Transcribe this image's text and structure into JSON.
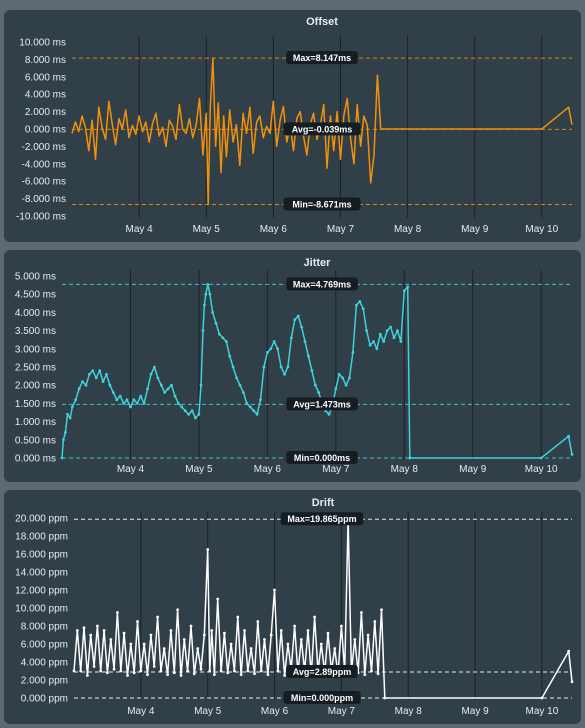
{
  "colors": {
    "background": "#5d6a72",
    "panel": "#303f48",
    "offset": "#f0910c",
    "jitter": "#3fd2db",
    "drift": "#ffffff",
    "label_bg": "#151d22"
  },
  "chart_data": [
    {
      "type": "line",
      "title": "Offset",
      "x_ticks": [
        "May 4",
        "May 5",
        "May 6",
        "May 7",
        "May 8",
        "May 9",
        "May 10"
      ],
      "y_ticks": [
        "10.000 ms",
        "8.000 ms",
        "6.000 ms",
        "4.000 ms",
        "2.000 ms",
        "0.000 ms",
        "-2.000 ms",
        "-4.000 ms",
        "-6.000 ms",
        "-8.000 ms",
        "-10.000 ms"
      ],
      "ylim": [
        -10,
        10
      ],
      "unit": "ms",
      "series_color": "#f0910c",
      "markers": false,
      "reference_lines": [
        {
          "label": "Max=8.147ms",
          "value": 8.147
        },
        {
          "label": "Avg=-0.039ms",
          "value": -0.039
        },
        {
          "label": "Min=-8.671ms",
          "value": -8.671
        }
      ],
      "series_x_days": [
        3.0,
        7.6,
        10.0,
        10.4
      ],
      "series_points": [
        [
          3.0,
          -0.5
        ],
        [
          3.05,
          0.8
        ],
        [
          3.1,
          -0.3
        ],
        [
          3.15,
          1.5
        ],
        [
          3.2,
          0.2
        ],
        [
          3.25,
          -2.5
        ],
        [
          3.3,
          1.0
        ],
        [
          3.35,
          -3.5
        ],
        [
          3.4,
          2.5
        ],
        [
          3.45,
          0.1
        ],
        [
          3.5,
          -1.2
        ],
        [
          3.55,
          3.2
        ],
        [
          3.6,
          0.5
        ],
        [
          3.65,
          -1.8
        ],
        [
          3.7,
          1.2
        ],
        [
          3.75,
          0.0
        ],
        [
          3.8,
          2.2
        ],
        [
          3.85,
          -1.0
        ],
        [
          3.9,
          0.4
        ],
        [
          3.95,
          -0.6
        ],
        [
          4.0,
          1.5
        ],
        [
          4.05,
          -0.3
        ],
        [
          4.1,
          0.8
        ],
        [
          4.15,
          -1.5
        ],
        [
          4.2,
          0.6
        ],
        [
          4.25,
          1.8
        ],
        [
          4.3,
          -0.8
        ],
        [
          4.35,
          0.2
        ],
        [
          4.4,
          -2.0
        ],
        [
          4.45,
          1.0
        ],
        [
          4.5,
          0.3
        ],
        [
          4.55,
          -1.2
        ],
        [
          4.6,
          2.8
        ],
        [
          4.65,
          0.0
        ],
        [
          4.7,
          -0.5
        ],
        [
          4.75,
          1.2
        ],
        [
          4.8,
          -1.0
        ],
        [
          4.85,
          0.5
        ],
        [
          4.9,
          3.5
        ],
        [
          4.95,
          -3.0
        ],
        [
          5.0,
          1.8
        ],
        [
          5.03,
          -8.671
        ],
        [
          5.06,
          2.5
        ],
        [
          5.1,
          8.147
        ],
        [
          5.14,
          -2.0
        ],
        [
          5.18,
          3.0
        ],
        [
          5.22,
          -5.0
        ],
        [
          5.26,
          1.5
        ],
        [
          5.3,
          -3.2
        ],
        [
          5.35,
          2.2
        ],
        [
          5.4,
          -1.5
        ],
        [
          5.45,
          0.5
        ],
        [
          5.5,
          -4.2
        ],
        [
          5.55,
          1.8
        ],
        [
          5.6,
          -0.5
        ],
        [
          5.65,
          2.5
        ],
        [
          5.7,
          -2.8
        ],
        [
          5.75,
          0.8
        ],
        [
          5.8,
          1.5
        ],
        [
          5.85,
          -1.0
        ],
        [
          5.9,
          0.3
        ],
        [
          5.95,
          -0.5
        ],
        [
          6.0,
          3.2
        ],
        [
          6.05,
          -2.0
        ],
        [
          6.1,
          1.0
        ],
        [
          6.15,
          2.6
        ],
        [
          6.2,
          -1.5
        ],
        [
          6.25,
          0.5
        ],
        [
          6.3,
          -2.5
        ],
        [
          6.35,
          1.2
        ],
        [
          6.4,
          2.0
        ],
        [
          6.45,
          -0.8
        ],
        [
          6.5,
          -3.0
        ],
        [
          6.55,
          0.6
        ],
        [
          6.6,
          1.8
        ],
        [
          6.65,
          -1.2
        ],
        [
          6.7,
          0.4
        ],
        [
          6.75,
          2.8
        ],
        [
          6.8,
          -4.5
        ],
        [
          6.85,
          1.5
        ],
        [
          6.9,
          -2.5
        ],
        [
          6.95,
          2.0
        ],
        [
          7.0,
          -3.5
        ],
        [
          7.05,
          1.5
        ],
        [
          7.1,
          3.5
        ],
        [
          7.15,
          -1.0
        ],
        [
          7.2,
          -4.0
        ],
        [
          7.25,
          2.8
        ],
        [
          7.3,
          -2.0
        ],
        [
          7.35,
          1.5
        ],
        [
          7.4,
          0.4
        ],
        [
          7.45,
          -6.2
        ],
        [
          7.5,
          -3.0
        ],
        [
          7.55,
          6.2
        ],
        [
          7.6,
          0.0
        ],
        [
          10.0,
          0.0
        ],
        [
          10.4,
          2.5
        ],
        [
          10.45,
          0.5
        ]
      ]
    },
    {
      "type": "line",
      "title": "Jitter",
      "x_ticks": [
        "May 4",
        "May 5",
        "May 6",
        "May 7",
        "May 8",
        "May 9",
        "May 10"
      ],
      "y_ticks": [
        "5.000 ms",
        "4.500 ms",
        "4.000 ms",
        "3.500 ms",
        "3.000 ms",
        "2.500 ms",
        "2.000 ms",
        "1.500 ms",
        "1.000 ms",
        "0.500 ms",
        "0.000 ms"
      ],
      "ylim": [
        0,
        5
      ],
      "unit": "ms",
      "series_color": "#3fd2db",
      "markers": true,
      "reference_lines": [
        {
          "label": "Max=4.769ms",
          "value": 4.769
        },
        {
          "label": "Avg=1.473ms",
          "value": 1.473
        },
        {
          "label": "Min=0.000ms",
          "value": 0.0
        }
      ],
      "series_points": [
        [
          3.0,
          0.0
        ],
        [
          3.02,
          0.5
        ],
        [
          3.05,
          0.7
        ],
        [
          3.08,
          1.2
        ],
        [
          3.12,
          1.1
        ],
        [
          3.15,
          1.4
        ],
        [
          3.2,
          1.6
        ],
        [
          3.25,
          1.9
        ],
        [
          3.3,
          2.1
        ],
        [
          3.35,
          2.0
        ],
        [
          3.4,
          2.3
        ],
        [
          3.45,
          2.4
        ],
        [
          3.5,
          2.2
        ],
        [
          3.55,
          2.4
        ],
        [
          3.6,
          2.1
        ],
        [
          3.65,
          2.3
        ],
        [
          3.7,
          2.0
        ],
        [
          3.75,
          1.8
        ],
        [
          3.8,
          1.6
        ],
        [
          3.85,
          1.7
        ],
        [
          3.9,
          1.5
        ],
        [
          3.95,
          1.6
        ],
        [
          4.0,
          1.4
        ],
        [
          4.05,
          1.6
        ],
        [
          4.1,
          1.5
        ],
        [
          4.15,
          1.7
        ],
        [
          4.2,
          1.5
        ],
        [
          4.25,
          1.9
        ],
        [
          4.3,
          2.3
        ],
        [
          4.35,
          2.5
        ],
        [
          4.4,
          2.2
        ],
        [
          4.45,
          2.0
        ],
        [
          4.5,
          1.8
        ],
        [
          4.55,
          1.9
        ],
        [
          4.6,
          2.0
        ],
        [
          4.65,
          1.7
        ],
        [
          4.7,
          1.5
        ],
        [
          4.75,
          1.4
        ],
        [
          4.8,
          1.3
        ],
        [
          4.85,
          1.2
        ],
        [
          4.9,
          1.3
        ],
        [
          4.95,
          1.1
        ],
        [
          5.0,
          1.2
        ],
        [
          5.03,
          2.0
        ],
        [
          5.06,
          3.5
        ],
        [
          5.08,
          4.2
        ],
        [
          5.1,
          4.5
        ],
        [
          5.13,
          4.769
        ],
        [
          5.16,
          4.5
        ],
        [
          5.2,
          4.0
        ],
        [
          5.25,
          3.7
        ],
        [
          5.3,
          3.4
        ],
        [
          5.35,
          3.3
        ],
        [
          5.4,
          3.2
        ],
        [
          5.45,
          2.8
        ],
        [
          5.5,
          2.5
        ],
        [
          5.55,
          2.2
        ],
        [
          5.6,
          2.0
        ],
        [
          5.65,
          1.8
        ],
        [
          5.7,
          1.5
        ],
        [
          5.75,
          1.4
        ],
        [
          5.8,
          1.3
        ],
        [
          5.85,
          1.2
        ],
        [
          5.9,
          1.6
        ],
        [
          5.95,
          2.5
        ],
        [
          6.0,
          2.9
        ],
        [
          6.05,
          3.0
        ],
        [
          6.1,
          3.2
        ],
        [
          6.15,
          3.0
        ],
        [
          6.2,
          2.5
        ],
        [
          6.25,
          2.3
        ],
        [
          6.3,
          2.5
        ],
        [
          6.35,
          3.3
        ],
        [
          6.4,
          3.8
        ],
        [
          6.45,
          3.9
        ],
        [
          6.5,
          3.6
        ],
        [
          6.55,
          3.2
        ],
        [
          6.6,
          2.8
        ],
        [
          6.65,
          2.4
        ],
        [
          6.7,
          2.0
        ],
        [
          6.75,
          1.8
        ],
        [
          6.8,
          1.5
        ],
        [
          6.85,
          1.3
        ],
        [
          6.9,
          1.2
        ],
        [
          6.95,
          1.4
        ],
        [
          7.0,
          1.9
        ],
        [
          7.05,
          2.3
        ],
        [
          7.1,
          2.2
        ],
        [
          7.15,
          2.0
        ],
        [
          7.2,
          2.2
        ],
        [
          7.25,
          2.9
        ],
        [
          7.3,
          4.2
        ],
        [
          7.35,
          4.3
        ],
        [
          7.4,
          4.1
        ],
        [
          7.45,
          3.5
        ],
        [
          7.5,
          3.1
        ],
        [
          7.55,
          3.2
        ],
        [
          7.6,
          3.0
        ],
        [
          7.65,
          3.4
        ],
        [
          7.7,
          3.2
        ],
        [
          7.75,
          3.5
        ],
        [
          7.8,
          3.6
        ],
        [
          7.85,
          3.3
        ],
        [
          7.9,
          3.5
        ],
        [
          7.95,
          3.2
        ],
        [
          8.0,
          4.6
        ],
        [
          8.05,
          4.7
        ],
        [
          8.08,
          0.0
        ],
        [
          10.0,
          0.0
        ],
        [
          10.4,
          0.6
        ],
        [
          10.45,
          0.1
        ]
      ]
    },
    {
      "type": "line",
      "title": "Drift",
      "x_ticks": [
        "May 4",
        "May 5",
        "May 6",
        "May 7",
        "May 8",
        "May 9",
        "May 10"
      ],
      "y_ticks": [
        "20.000 ppm",
        "18.000 ppm",
        "16.000 ppm",
        "14.000 ppm",
        "12.000 ppm",
        "10.000 ppm",
        "8.000 ppm",
        "6.000 ppm",
        "4.000 ppm",
        "2.000 ppm",
        "0.000 ppm"
      ],
      "ylim": [
        0,
        20
      ],
      "unit": "ppm",
      "series_color": "#ffffff",
      "markers": true,
      "reference_lines": [
        {
          "label": "Max=19.865ppm",
          "value": 19.865
        },
        {
          "label": "Avg=2.89ppm",
          "value": 2.89
        },
        {
          "label": "Min=0.000ppm",
          "value": 0.0
        }
      ],
      "series_points": [
        [
          3.0,
          3.0
        ],
        [
          3.05,
          7.5
        ],
        [
          3.1,
          3.0
        ],
        [
          3.15,
          7.8
        ],
        [
          3.2,
          2.5
        ],
        [
          3.25,
          7.0
        ],
        [
          3.3,
          3.5
        ],
        [
          3.35,
          8.0
        ],
        [
          3.4,
          3.0
        ],
        [
          3.45,
          7.5
        ],
        [
          3.5,
          2.8
        ],
        [
          3.55,
          6.5
        ],
        [
          3.6,
          3.2
        ],
        [
          3.65,
          9.5
        ],
        [
          3.7,
          3.0
        ],
        [
          3.75,
          7.2
        ],
        [
          3.8,
          2.5
        ],
        [
          3.85,
          6.0
        ],
        [
          3.9,
          2.8
        ],
        [
          3.95,
          8.5
        ],
        [
          4.0,
          3.0
        ],
        [
          4.05,
          6.0
        ],
        [
          4.1,
          2.6
        ],
        [
          4.15,
          7.0
        ],
        [
          4.2,
          3.5
        ],
        [
          4.25,
          9.0
        ],
        [
          4.3,
          3.0
        ],
        [
          4.35,
          5.5
        ],
        [
          4.4,
          2.6
        ],
        [
          4.45,
          7.5
        ],
        [
          4.5,
          2.8
        ],
        [
          4.55,
          9.8
        ],
        [
          4.6,
          2.5
        ],
        [
          4.65,
          6.5
        ],
        [
          4.7,
          3.0
        ],
        [
          4.75,
          8.0
        ],
        [
          4.8,
          2.7
        ],
        [
          4.85,
          5.5
        ],
        [
          4.9,
          3.2
        ],
        [
          4.95,
          7.0
        ],
        [
          5.0,
          16.5
        ],
        [
          5.03,
          3.0
        ],
        [
          5.06,
          7.5
        ],
        [
          5.1,
          2.6
        ],
        [
          5.15,
          11.0
        ],
        [
          5.2,
          3.0
        ],
        [
          5.25,
          7.2
        ],
        [
          5.3,
          2.8
        ],
        [
          5.35,
          6.0
        ],
        [
          5.4,
          3.0
        ],
        [
          5.45,
          9.0
        ],
        [
          5.5,
          2.6
        ],
        [
          5.55,
          7.5
        ],
        [
          5.6,
          3.0
        ],
        [
          5.65,
          5.5
        ],
        [
          5.7,
          2.7
        ],
        [
          5.75,
          8.5
        ],
        [
          5.8,
          3.0
        ],
        [
          5.85,
          6.5
        ],
        [
          5.9,
          2.6
        ],
        [
          5.95,
          7.0
        ],
        [
          6.0,
          12.0
        ],
        [
          6.05,
          3.0
        ],
        [
          6.1,
          7.5
        ],
        [
          6.15,
          2.5
        ],
        [
          6.2,
          6.0
        ],
        [
          6.25,
          3.2
        ],
        [
          6.3,
          8.0
        ],
        [
          6.35,
          2.8
        ],
        [
          6.4,
          6.5
        ],
        [
          6.45,
          3.0
        ],
        [
          6.5,
          7.5
        ],
        [
          6.55,
          2.5
        ],
        [
          6.6,
          9.0
        ],
        [
          6.65,
          3.0
        ],
        [
          6.7,
          6.0
        ],
        [
          6.75,
          2.8
        ],
        [
          6.8,
          7.2
        ],
        [
          6.85,
          3.0
        ],
        [
          6.9,
          5.5
        ],
        [
          6.95,
          2.6
        ],
        [
          7.0,
          8.0
        ],
        [
          7.05,
          3.0
        ],
        [
          7.1,
          19.865
        ],
        [
          7.15,
          3.0
        ],
        [
          7.2,
          6.5
        ],
        [
          7.25,
          2.8
        ],
        [
          7.3,
          9.5
        ],
        [
          7.35,
          2.6
        ],
        [
          7.4,
          7.0
        ],
        [
          7.45,
          3.0
        ],
        [
          7.5,
          8.5
        ],
        [
          7.55,
          2.7
        ],
        [
          7.6,
          9.8
        ],
        [
          7.65,
          0.0
        ],
        [
          10.0,
          0.0
        ],
        [
          10.4,
          5.2
        ],
        [
          10.45,
          1.8
        ]
      ]
    }
  ]
}
